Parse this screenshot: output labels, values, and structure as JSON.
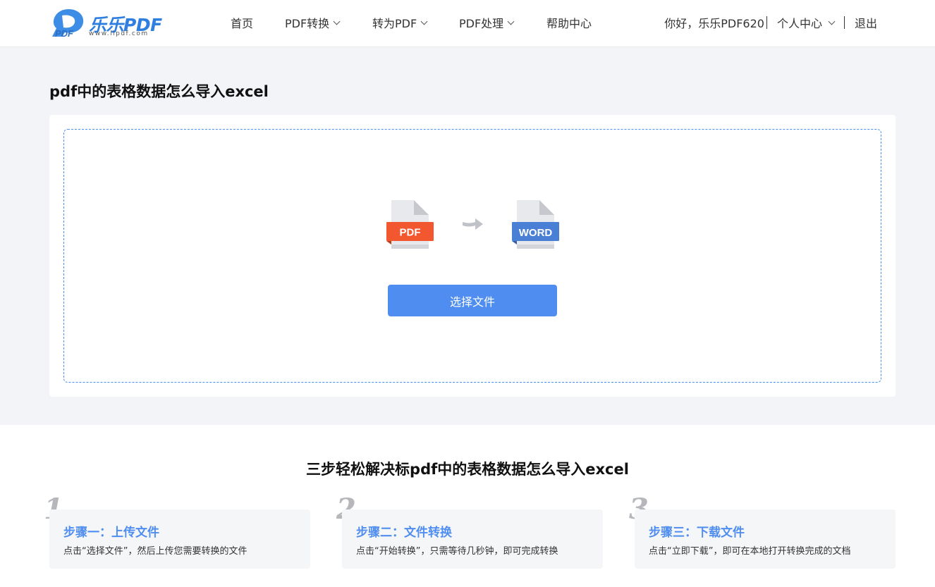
{
  "header": {
    "logo_text": "乐乐PDF",
    "logo_url": "www.llpdf.com",
    "nav": [
      {
        "label": "首页",
        "dropdown": false
      },
      {
        "label": "PDF转换",
        "dropdown": true
      },
      {
        "label": "转为PDF",
        "dropdown": true
      },
      {
        "label": "PDF处理",
        "dropdown": true
      },
      {
        "label": "帮助中心",
        "dropdown": false
      }
    ],
    "greeting": "你好，乐乐PDF620",
    "user_center": "个人中心",
    "logout": "退出"
  },
  "main": {
    "title": "pdf中的表格数据怎么导入excel",
    "from_label": "PDF",
    "to_label": "WORD",
    "select_button": "选择文件"
  },
  "steps_section": {
    "title": "三步轻松解决标pdf中的表格数据怎么导入excel",
    "steps": [
      {
        "num": "1",
        "title": "步骤一：上传文件",
        "desc": "点击“选择文件”，然后上传您需要转换的文件"
      },
      {
        "num": "2",
        "title": "步骤二：文件转换",
        "desc": "点击“开始转换”，只需等待几秒钟，即可完成转换"
      },
      {
        "num": "3",
        "title": "步骤三：下载文件",
        "desc": "点击“立即下载”，即可在本地打开转换完成的文档"
      }
    ]
  },
  "colors": {
    "accent": "#4f8ef0",
    "pdf_red": "#f2572f",
    "word_blue": "#4a7fd6",
    "background_gray": "#f3f4f7"
  }
}
